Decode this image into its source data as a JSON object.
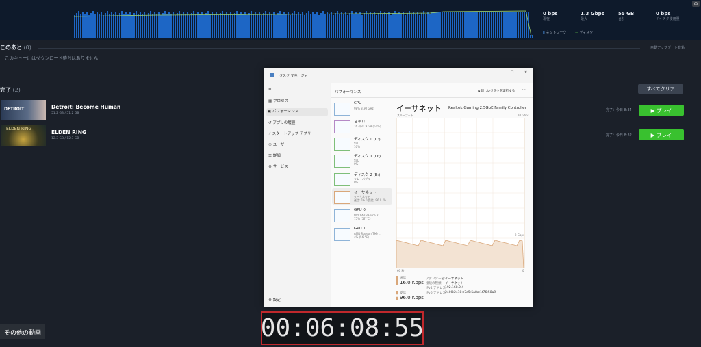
{
  "stats": [
    {
      "value": "0 bps",
      "label": "現在"
    },
    {
      "value": "1.3 Gbps",
      "label": "最大"
    },
    {
      "value": "55 GB",
      "label": "合計"
    },
    {
      "value": "0 bps",
      "label": "ディスク使用量"
    }
  ],
  "legend": {
    "network": "ネットワーク",
    "disk": "ディスク"
  },
  "upcoming": {
    "title": "このあと",
    "count": "(0)",
    "empty": "このキューにはダウンロード待ちはありません",
    "auto_update": "自動アップデート有効"
  },
  "completed": {
    "title": "完了",
    "count": "(2)",
    "clear_all": "すべてクリア"
  },
  "games": [
    {
      "name": "Detroit: Become Human",
      "size": "51.2 GB / 51.2 GB",
      "done": "完了：今日 8:34",
      "play": "▶ プレイ",
      "thumb_text": "DETROIT"
    },
    {
      "name": "ELDEN RING",
      "size": "12.3 GB / 12.3 GB",
      "done": "完了：今日 8:32",
      "play": "▶ プレイ",
      "thumb_text": "ELDEN RING"
    }
  ],
  "task_manager": {
    "title": "タスク マネージャー",
    "section": "パフォーマンス",
    "run_new": "新しいタスクを実行する",
    "nav": [
      "プロセス",
      "パフォーマンス",
      "アプリの履歴",
      "スタートアップ アプリ",
      "ユーザー",
      "詳細",
      "サービス"
    ],
    "settings": "設定",
    "devices": [
      {
        "name": "CPU",
        "sub": "98% 3.90 GHz"
      },
      {
        "name": "メモリ",
        "sub": "16.4/31.9 GB (51%)"
      },
      {
        "name": "ディスク 0 (C:)",
        "sub": "SSD\n10%"
      },
      {
        "name": "ディスク 1 (D:)",
        "sub": "SSD\n0%"
      },
      {
        "name": "ディスク 2 (E:)",
        "sub": "リム - バブル\n0%"
      },
      {
        "name": "イーサネット",
        "sub": "イーサネット\n送信: 16.0 受信: 96.0 Kb"
      },
      {
        "name": "GPU 0",
        "sub": "NVIDIA GeForce R...\n75% (57 °C)"
      },
      {
        "name": "GPU 1",
        "sub": "AMD Radeon(TM) ...\n4% (56 °C)"
      }
    ],
    "ethernet": {
      "heading": "イーサネット",
      "adapter": "Realtek Gaming 2.5GbE Family Controller",
      "throughput": "スループット",
      "max": "10 Gbps",
      "mid": "2 Gbps",
      "time": "60 秒",
      "zero": "0",
      "send_label": "送信",
      "send_value": "16.0 Kbps",
      "recv_label": "受信",
      "recv_value": "96.0 Kbps",
      "details": [
        [
          "アダプター名:",
          "イーサネット"
        ],
        [
          "接続の種類:",
          "イーサネット"
        ],
        [
          "IPv4 アドレス:",
          "192.168.0.4"
        ],
        [
          "IPv6 アドレス:",
          "2400:2410:c7a5:5a8a:1f76:58a9"
        ]
      ]
    }
  },
  "timer": "00:06:08:55",
  "more_videos": "その他の動画",
  "colors": {
    "play_green": "#39c12f",
    "graph_blue": "#1f6fd6",
    "ethernet_orange": "#d9a77a",
    "timer_border": "#c0282c"
  }
}
